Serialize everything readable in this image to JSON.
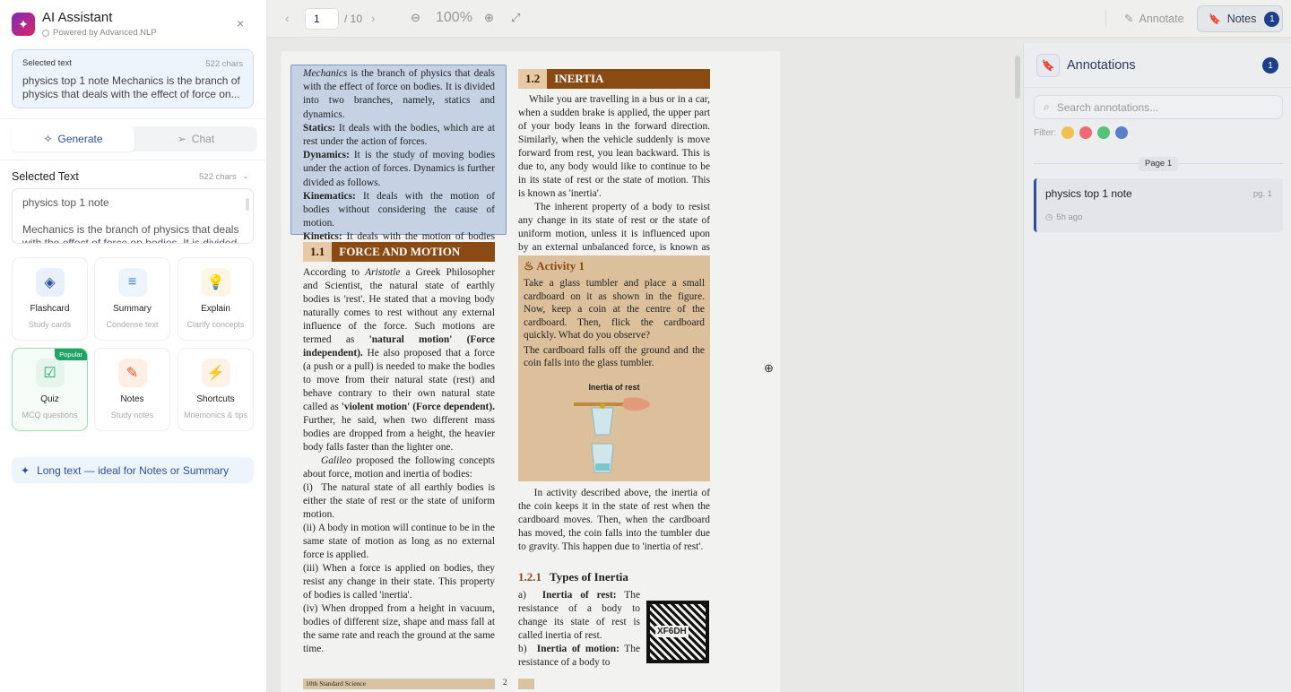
{
  "ai_panel": {
    "title": "AI Assistant",
    "subtitle": "Powered by Advanced NLP",
    "close_glyph": "×",
    "logo_glyph": "✦",
    "selection_preview": {
      "label": "Selected text",
      "chars": "522 chars",
      "text": "physics top 1 note Mechanics is the branch of physics that deals with the effect of force on..."
    },
    "tabs": [
      {
        "label": "Generate",
        "icon": "sparkle-icon",
        "glyph": "✧",
        "active": true
      },
      {
        "label": "Chat",
        "icon": "send-icon",
        "glyph": "➢",
        "active": false
      }
    ],
    "selected_text": {
      "title": "Selected Text",
      "chars": "522 chars",
      "chevron": "⌄",
      "line1": "physics top 1 note",
      "line2": "Mechanics is the branch of physics that deals with the effect of force on bodies. It is divided"
    },
    "tools": [
      {
        "name": "Flashcard",
        "desc": "Study cards",
        "glyph": "◈",
        "color": "#2b4f9a",
        "bg": "#eaf0f9"
      },
      {
        "name": "Summary",
        "desc": "Condense text",
        "glyph": "≡",
        "color": "#3b82c4",
        "bg": "#eef4fb"
      },
      {
        "name": "Explain",
        "desc": "Clarify concepts",
        "glyph": "💡",
        "color": "#e0a800",
        "bg": "#fdf6e6"
      },
      {
        "name": "Quiz",
        "desc": "MCQ questions",
        "glyph": "☑",
        "color": "#21a366",
        "bg": "#e5f5ec",
        "badge": "Popular"
      },
      {
        "name": "Notes",
        "desc": "Study notes",
        "glyph": "✎",
        "color": "#e05a1a",
        "bg": "#fdeee6"
      },
      {
        "name": "Shortcuts",
        "desc": "Mnemonics & tips",
        "glyph": "⚡",
        "color": "#e07a1a",
        "bg": "#fdf2e6"
      }
    ],
    "hint": {
      "text": "Long text — ideal for Notes or Summary",
      "glyph": "✦"
    }
  },
  "toolbar": {
    "prev_glyph": "‹",
    "next_glyph": "›",
    "page_current": "1",
    "page_total": "/ 10",
    "zoom_out_glyph": "⊖",
    "zoom_in_glyph": "⊕",
    "zoom": "100%",
    "fit_glyph": "⤢",
    "annotate_label": "Annotate",
    "annotate_glyph": "✎",
    "notes_label": "Notes",
    "notes_glyph": "🔖",
    "notes_count": "1"
  },
  "pdf": {
    "highlight_html": "<i>Mechanics</i> is the branch of physics that deals with the effect of force on bodies. It is divided into two branches, namely, statics and dynamics.<br><b>Statics:</b> It deals with the bodies, which are at rest under the action of forces.<br><b>Dynamics:</b> It is the study of moving bodies under the action of forces. Dynamics is further divided as follows.<br><b>Kinematics:</b> It deals with the motion of bodies without considering the cause of motion.<br><b>Kinetics:</b> It deals with the motion of bodies considering the cause of motion.",
    "sec_1_1": {
      "num": "1.1",
      "title": "FORCE AND MOTION"
    },
    "left_body_html": "According to <i>Aristotle</i> a Greek Philosopher and Scientist, the natural state of earthly bodies is 'rest'. He stated that a moving body naturally comes to rest without any external influence of the force. Such motions are termed as <b>'natural motion' (Force independent).</b> He also proposed that a force (a push or a pull) is needed to make the bodies to move from their natural state (rest) and behave contrary to their own natural state called as <b>'violent motion' (Force dependent).</b> Further, he said, when two different mass bodies are dropped from a height, the heavier body falls faster than the lighter one.<br>&nbsp;&nbsp;&nbsp;&nbsp;<i>Galileo</i> proposed the following concepts about force, motion and inertia of bodies:<br>(i)&nbsp;&nbsp;The natural state of all earthly bodies is either the state of rest or the state of uniform motion.<br>(ii)&nbsp;A body in motion will continue to be in the same state of motion as long as no external force is applied.<br>(iii) When a force is applied on bodies, they resist any change in their state. This property of bodies is called 'inertia'.<br>(iv) When dropped from a height in vacuum, bodies of different size, shape and mass fall at the same rate and reach the ground at the same time.",
    "sec_1_2": {
      "num": "1.2",
      "title": "INERTIA"
    },
    "right_body_html": "&nbsp;&nbsp;&nbsp;&nbsp;While you are travelling in a bus or in a car, when a sudden brake is applied, the upper part of your body leans in the forward direction. Similarly, when the vehicle suddenly is move forward from rest, you lean backward. This is due to, any body would like to continue to be in its state of rest or the state of motion. This is known as 'inertia'.<br>&nbsp;&nbsp;&nbsp;&nbsp;The inherent property of a body to resist any change in its state of rest or the state of uniform motion, unless it is influenced upon by an external unbalanced force, is known as <b>'inertia'.</b>",
    "activity": {
      "title": "Activity 1",
      "glyph": "♨",
      "body": "Take a glass tumbler and place a small cardboard on it as shown in the figure. Now, keep a coin at the centre of the cardboard. Then, flick the cardboard quickly. What do you observe?",
      "body2": "The cardboard falls off the ground and the coin falls into the glass tumbler.",
      "caption": "Inertia of rest"
    },
    "after_activity_html": "&nbsp;&nbsp;&nbsp;&nbsp;In activity described above, the inertia of the coin keeps it in the state of rest when the cardboard moves. Then, when the cardboard has moved, the coin falls into the tumbler due to gravity. This happen due to 'inertia of rest'.",
    "sub_1_2_1": {
      "num": "1.2.1",
      "title": "Types of Inertia"
    },
    "types_html": "a)&nbsp;&nbsp;<b>Inertia of rest:</b> The resistance of a body to change its state of rest is called inertia of rest.<br>b)&nbsp;&nbsp;<b>Inertia of motion:</b> The resistance of a body to",
    "qr_label": "XF6DH",
    "footer": "10th Standard Science",
    "page_num": "2"
  },
  "annotations": {
    "title": "Annotations",
    "glyph": "🔖",
    "count": "1",
    "search_placeholder": "Search annotations...",
    "search_glyph": "⌕",
    "filter_label": "Filter:",
    "filter_colors": [
      "#f2c14e",
      "#ef6b73",
      "#55c27a",
      "#5b7fc7"
    ],
    "page_tag": "Page 1",
    "notes": [
      {
        "title": "physics top 1 note",
        "page": "pg. 1",
        "time": "5h ago",
        "time_glyph": "◷"
      }
    ]
  }
}
